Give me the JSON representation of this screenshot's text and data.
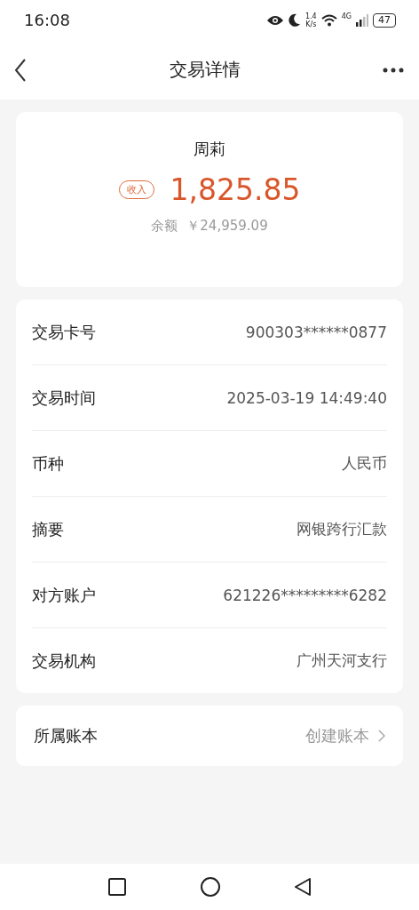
{
  "status_bar": {
    "time": "16:08",
    "speed_value": "1.4",
    "speed_unit": "K/s",
    "network": "4G",
    "battery": "47"
  },
  "header": {
    "title": "交易详情"
  },
  "summary": {
    "name": "周莉",
    "tag": "收入",
    "amount": "1,825.85",
    "balance_label": "余额",
    "balance": "￥24,959.09"
  },
  "details": [
    {
      "label": "交易卡号",
      "value": "900303******0877"
    },
    {
      "label": "交易时间",
      "value": "2025-03-19 14:49:40"
    },
    {
      "label": "币种",
      "value": "人民币"
    },
    {
      "label": "摘要",
      "value": "网银跨行汇款"
    },
    {
      "label": "对方账户",
      "value": "621226*********6282"
    },
    {
      "label": "交易机构",
      "value": "广州天河支行"
    }
  ],
  "ledger": {
    "label": "所属账本",
    "value": "创建账本"
  }
}
